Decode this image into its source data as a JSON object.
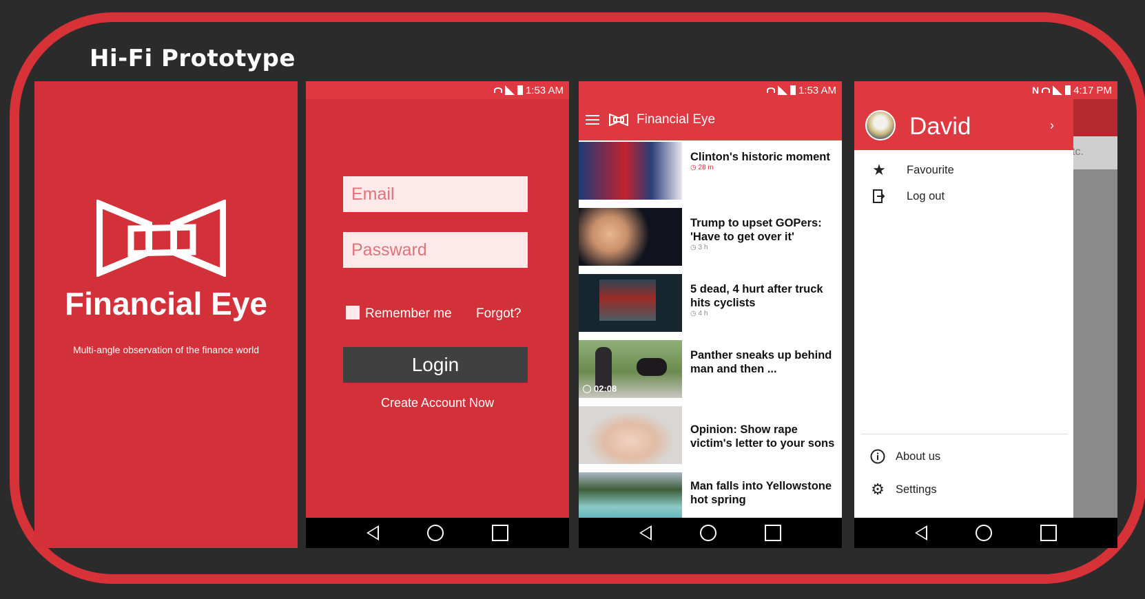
{
  "page": {
    "title": "Hi-Fi Prototype"
  },
  "splash": {
    "brand": "Financial Eye",
    "tagline": "Multi-angle observation of the finance world",
    "logo_icon": "financial-eye-logo"
  },
  "login": {
    "status_time": "1:53 AM",
    "email_placeholder": "Email",
    "password_placeholder": "Passward",
    "remember_label": "Remember me",
    "forgot_label": "Forgot?",
    "login_label": "Login",
    "create_label": "Create Account Now"
  },
  "feed": {
    "status_time": "1:53 AM",
    "app_title": "Financial Eye",
    "news": [
      {
        "headline": "Clinton's historic moment",
        "time": "28 m",
        "hot": true,
        "thumb": "#263b73"
      },
      {
        "headline": "Trump to upset GOPers: 'Have to get over it'",
        "time": "3 h",
        "hot": false,
        "thumb": "#1a1a22"
      },
      {
        "headline": "5 dead, 4 hurt after truck hits cyclists",
        "time": "4 h",
        "hot": false,
        "thumb": "#1c2b33"
      },
      {
        "headline": "Panther sneaks up behind man and then ...",
        "duration": "02:08",
        "thumb": "#6e8a5a"
      },
      {
        "headline": "Opinion: Show rape victim's letter to your sons",
        "thumb": "#e9d5c6"
      },
      {
        "headline": "Man falls into Yellowstone hot spring",
        "thumb": "#4e9aa6"
      }
    ]
  },
  "drawer": {
    "status_time": "4:17 PM",
    "user_name": "David",
    "behind_text": "tc.",
    "items": [
      {
        "label": "Favourite",
        "icon": "star-icon"
      },
      {
        "label": "Log out",
        "icon": "logout-icon"
      }
    ],
    "bottom_items": [
      {
        "label": "About us",
        "icon": "info-icon"
      },
      {
        "label": "Settings",
        "icon": "gear-icon"
      }
    ]
  },
  "colors": {
    "brand_red": "#d3313a",
    "statusbar_red": "#de3940",
    "dark_button": "#404040",
    "background": "#2b2b2c"
  }
}
